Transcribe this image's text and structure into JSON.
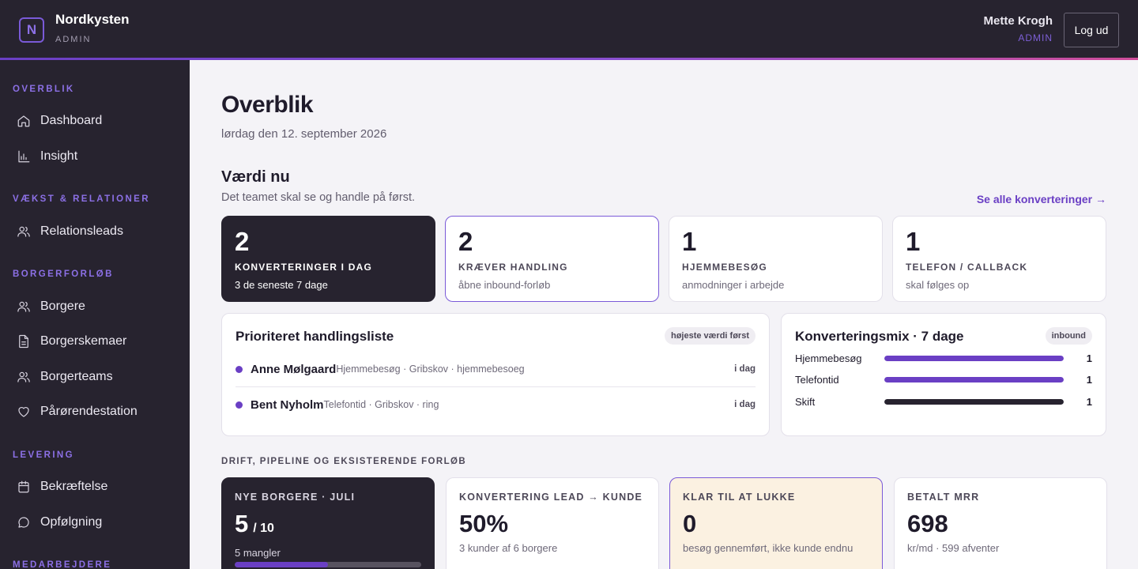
{
  "header": {
    "logo_letter": "N",
    "brand_name": "Nordkysten",
    "brand_role": "ADMIN",
    "user_name": "Mette Krogh",
    "user_role": "ADMIN",
    "logout_label": "Log ud"
  },
  "sidebar": {
    "sections": [
      {
        "title": "OVERBLIK",
        "items": [
          {
            "label": "Dashboard",
            "icon": "home-icon"
          },
          {
            "label": "Insight",
            "icon": "bar-chart-icon"
          }
        ]
      },
      {
        "title": "VÆKST & RELATIONER",
        "items": [
          {
            "label": "Relationsleads",
            "icon": "users-icon"
          }
        ]
      },
      {
        "title": "BORGERFORLØB",
        "items": [
          {
            "label": "Borgere",
            "icon": "users-icon"
          },
          {
            "label": "Borgerskemaer",
            "icon": "document-icon"
          },
          {
            "label": "Borgerteams",
            "icon": "users-icon"
          },
          {
            "label": "Pårørendestation",
            "icon": "heart-icon"
          }
        ]
      },
      {
        "title": "LEVERING",
        "items": [
          {
            "label": "Bekræftelse",
            "icon": "calendar-icon"
          },
          {
            "label": "Opfølgning",
            "icon": "chat-bubble-icon"
          }
        ]
      },
      {
        "title": "MEDARBEJDERE",
        "items": []
      }
    ]
  },
  "main": {
    "title": "Overblik",
    "date": "lørdag den 12. september 2026",
    "value_section": {
      "title": "Værdi nu",
      "subtitle": "Det teamet skal se og handle på først.",
      "link": "Se alle konverteringer →"
    },
    "kpis": [
      {
        "value": "2",
        "label": "KONVERTERINGER I DAG",
        "sub": "3 de seneste 7 dage",
        "style": "dark"
      },
      {
        "value": "2",
        "label": "KRÆVER HANDLING",
        "sub": "åbne inbound-forløb",
        "style": "outlined"
      },
      {
        "value": "1",
        "label": "HJEMMEBESØG",
        "sub": "anmodninger i arbejde",
        "style": "plain"
      },
      {
        "value": "1",
        "label": "TELEFON / CALLBACK",
        "sub": "skal følges op",
        "style": "plain"
      }
    ],
    "priority": {
      "title": "Prioriteret handlingsliste",
      "badge": "højeste værdi først",
      "rows": [
        {
          "name": "Anne Mølgaard",
          "meta": "Hjemmebesøg · Gribskov · hjemmebesoeg",
          "when": "i dag"
        },
        {
          "name": "Bent Nyholm",
          "meta": "Telefontid · Gribskov · ring",
          "when": "i dag"
        }
      ]
    },
    "mix": {
      "title": "Konverteringsmix · 7 dage",
      "badge": "inbound",
      "rows": [
        {
          "label": "Hjemmebesøg",
          "value": "1",
          "fraction": 1.0,
          "color": "#6a3fc4"
        },
        {
          "label": "Telefontid",
          "value": "1",
          "fraction": 1.0,
          "color": "#6a3fc4"
        },
        {
          "label": "Skift",
          "value": "1",
          "fraction": 1.0,
          "color": "#27232f"
        }
      ]
    },
    "ops_title": "DRIFT, PIPELINE OG EKSISTERENDE FORLØB",
    "ops": [
      {
        "label": "NYE BORGERE · JULI",
        "value": "5",
        "suffix": "/ 10",
        "sub": "5 mangler",
        "style": "dark",
        "progress": 0.5
      },
      {
        "label": "KONVERTERING LEAD → KUNDE",
        "value": "50%",
        "suffix": "",
        "sub": "3 kunder af 6 borgere",
        "style": "plain"
      },
      {
        "label": "KLAR TIL AT LUKKE",
        "value": "0",
        "suffix": "",
        "sub": "besøg gennemført, ikke kunde endnu",
        "style": "warm"
      },
      {
        "label": "BETALT MRR",
        "value": "698",
        "suffix": "",
        "sub": "kr/md · 599 afventer",
        "style": "plain"
      }
    ]
  }
}
